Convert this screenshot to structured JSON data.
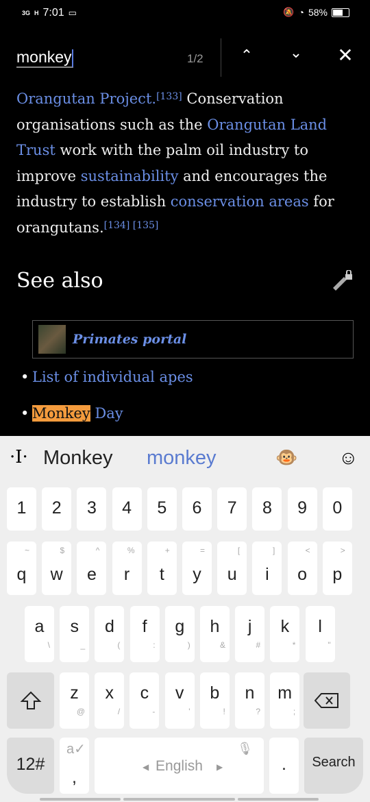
{
  "status": {
    "network1": "3G",
    "network2": "H",
    "time": "7:01",
    "battery": "58%",
    "battery_level": 0.58
  },
  "find": {
    "query": "monkey",
    "count": "1/2"
  },
  "article": {
    "p1": "Orangutan Project.",
    "r133": "[133]",
    "p2": " Conservation organisations such as the ",
    "l_olt": "Orangutan Land Trust",
    "p3": " work with the palm oil industry to improve ",
    "l_sus": "sustainability",
    "p4": " and encourages the industry to establish ",
    "l_ca": "conservation areas",
    "p5": " for orangutans.",
    "r134": "[134]",
    "r135": "[135]",
    "see_also": "See also",
    "portal": "Primates portal",
    "list": [
      {
        "label": "List of individual apes"
      },
      {
        "highlight": "Monkey",
        "rest": " Day"
      }
    ]
  },
  "keyboard": {
    "suggestions": [
      "Monkey",
      "monkey"
    ],
    "row_numbers": [
      "1",
      "2",
      "3",
      "4",
      "5",
      "6",
      "7",
      "8",
      "9",
      "0"
    ],
    "row1": [
      [
        "q",
        "~"
      ],
      [
        "w",
        "$"
      ],
      [
        "e",
        "^"
      ],
      [
        "r",
        "%"
      ],
      [
        "t",
        "+"
      ],
      [
        "y",
        "="
      ],
      [
        "u",
        "["
      ],
      [
        "i",
        "]"
      ],
      [
        "o",
        "<"
      ],
      [
        "p",
        ">"
      ]
    ],
    "row2": [
      [
        "a",
        "\\"
      ],
      [
        "s",
        "_"
      ],
      [
        "d",
        "("
      ],
      [
        "f",
        ":"
      ],
      [
        "g",
        ")"
      ],
      [
        "h",
        "&"
      ],
      [
        "j",
        "#"
      ],
      [
        "k",
        "*"
      ],
      [
        "l",
        "\""
      ]
    ],
    "row3": [
      [
        "z",
        "@"
      ],
      [
        "x",
        "/"
      ],
      [
        "c",
        "-"
      ],
      [
        "v",
        "'"
      ],
      [
        "b",
        "!"
      ],
      [
        "n",
        "?"
      ],
      [
        "m",
        ";"
      ]
    ],
    "sym_key": "12#",
    "comma": ",",
    "space": "English",
    "period": ".",
    "action": "Search"
  },
  "colors": {
    "link": "#6b8fe6",
    "highlight": "#f49b3d"
  }
}
